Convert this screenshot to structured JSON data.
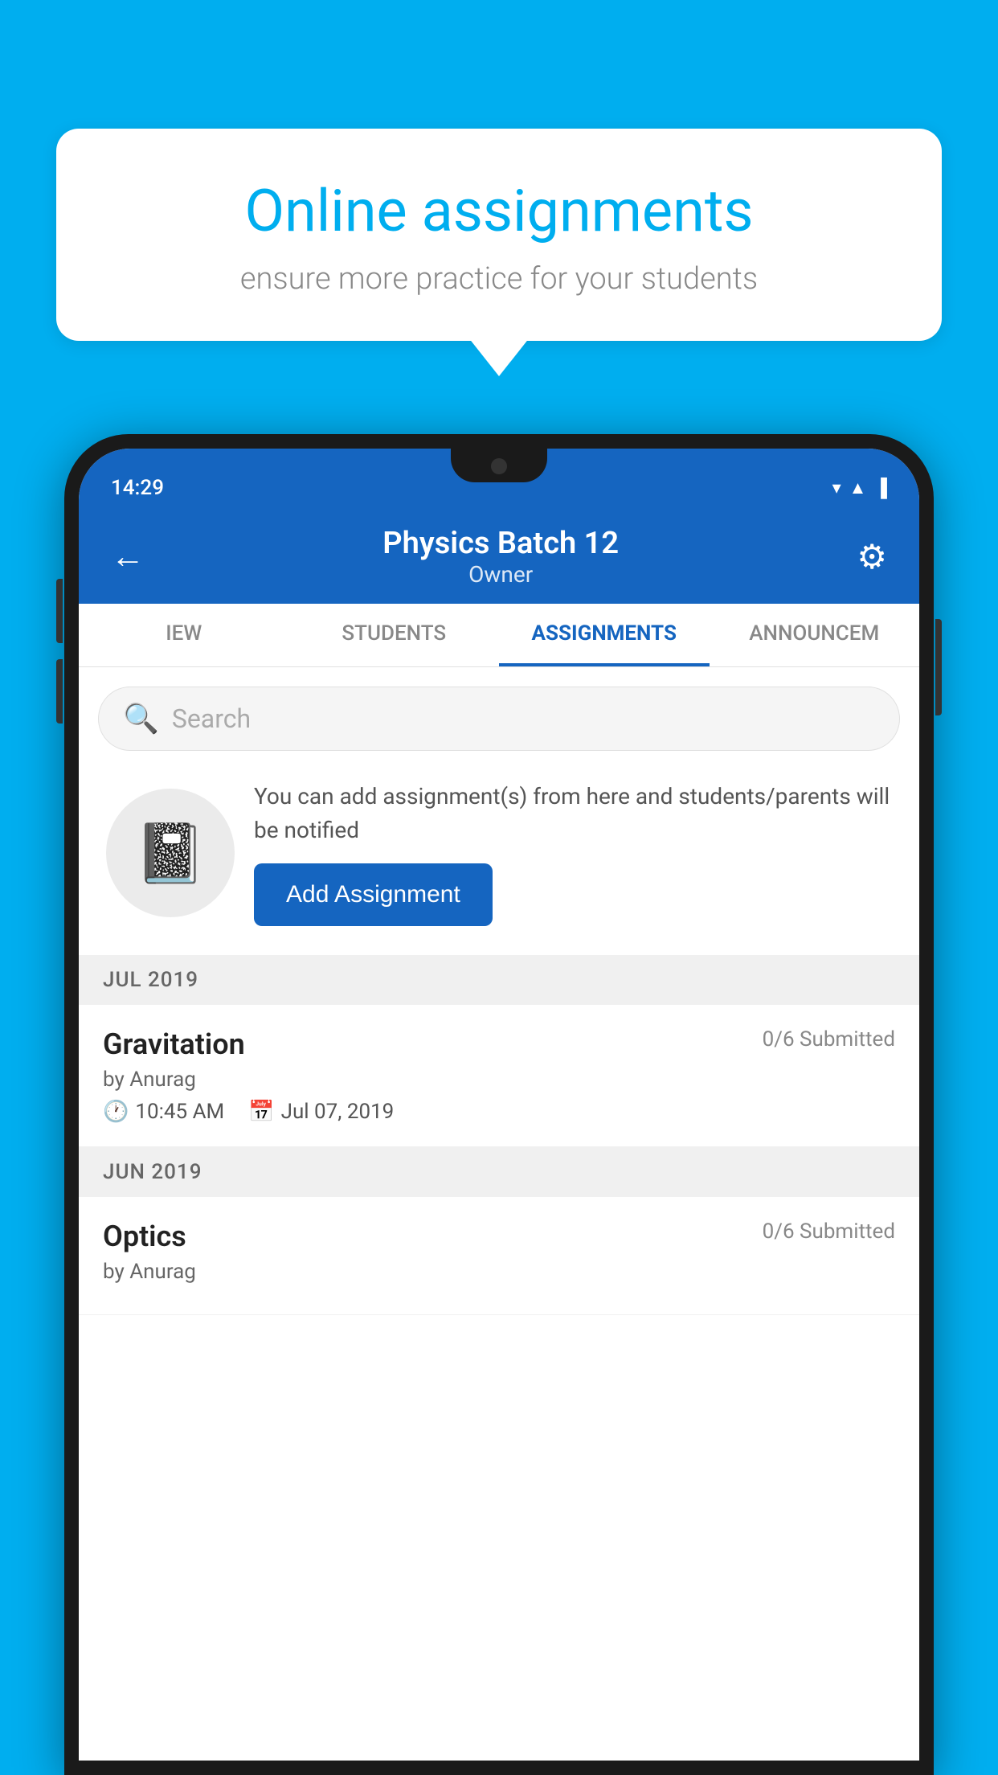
{
  "background_color": "#00AEEF",
  "speech_bubble": {
    "title": "Online assignments",
    "subtitle": "ensure more practice for your students"
  },
  "phone": {
    "status_bar": {
      "time": "14:29",
      "icons": [
        "▼",
        "▲",
        "▐"
      ]
    },
    "header": {
      "title": "Physics Batch 12",
      "subtitle": "Owner",
      "back_label": "←",
      "gear_label": "⚙"
    },
    "tabs": [
      {
        "label": "IEW",
        "active": false
      },
      {
        "label": "STUDENTS",
        "active": false
      },
      {
        "label": "ASSIGNMENTS",
        "active": true
      },
      {
        "label": "ANNOUNCEM",
        "active": false
      }
    ],
    "search": {
      "placeholder": "Search"
    },
    "info_card": {
      "description": "You can add assignment(s) from here and students/parents will be notified",
      "button_label": "Add Assignment"
    },
    "sections": [
      {
        "label": "JUL 2019",
        "assignments": [
          {
            "name": "Gravitation",
            "submitted": "0/6 Submitted",
            "by": "by Anurag",
            "time": "10:45 AM",
            "date": "Jul 07, 2019"
          }
        ]
      },
      {
        "label": "JUN 2019",
        "assignments": [
          {
            "name": "Optics",
            "submitted": "0/6 Submitted",
            "by": "by Anurag",
            "time": "",
            "date": ""
          }
        ]
      }
    ]
  }
}
